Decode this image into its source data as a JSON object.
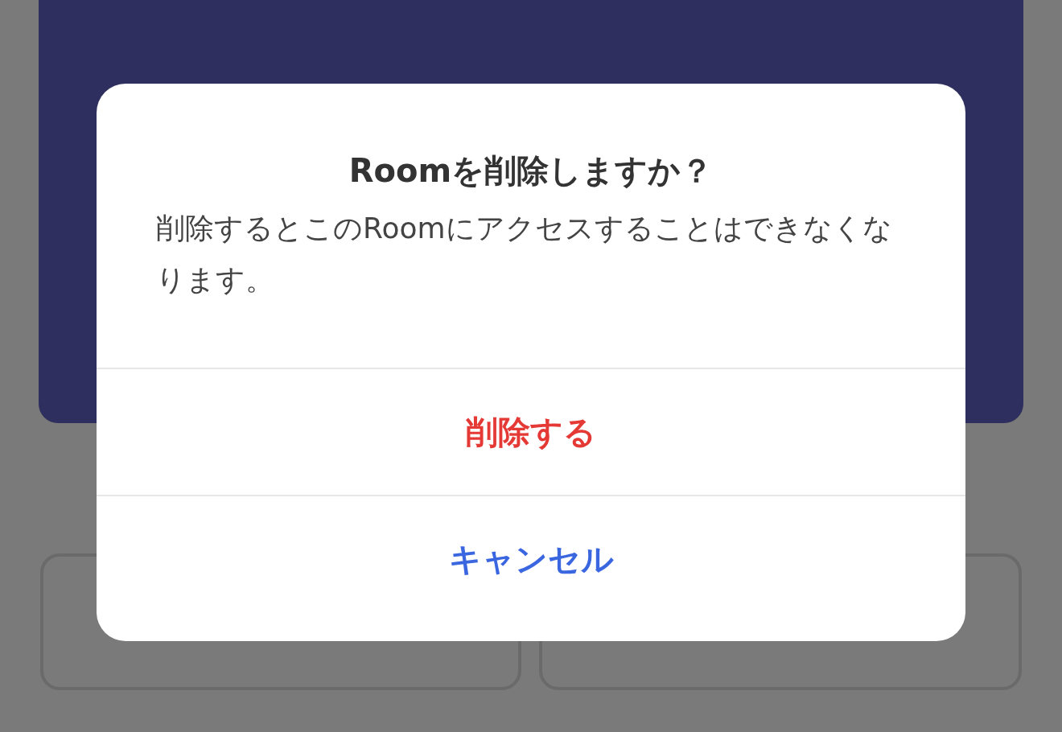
{
  "dialog": {
    "title": "Roomを削除しますか？",
    "message": "削除するとこのRoomにアクセスすることはできなくなります。",
    "actions": [
      {
        "label": "削除する",
        "kind": "destructive"
      },
      {
        "label": "キャンセル",
        "kind": "cancel"
      }
    ]
  }
}
